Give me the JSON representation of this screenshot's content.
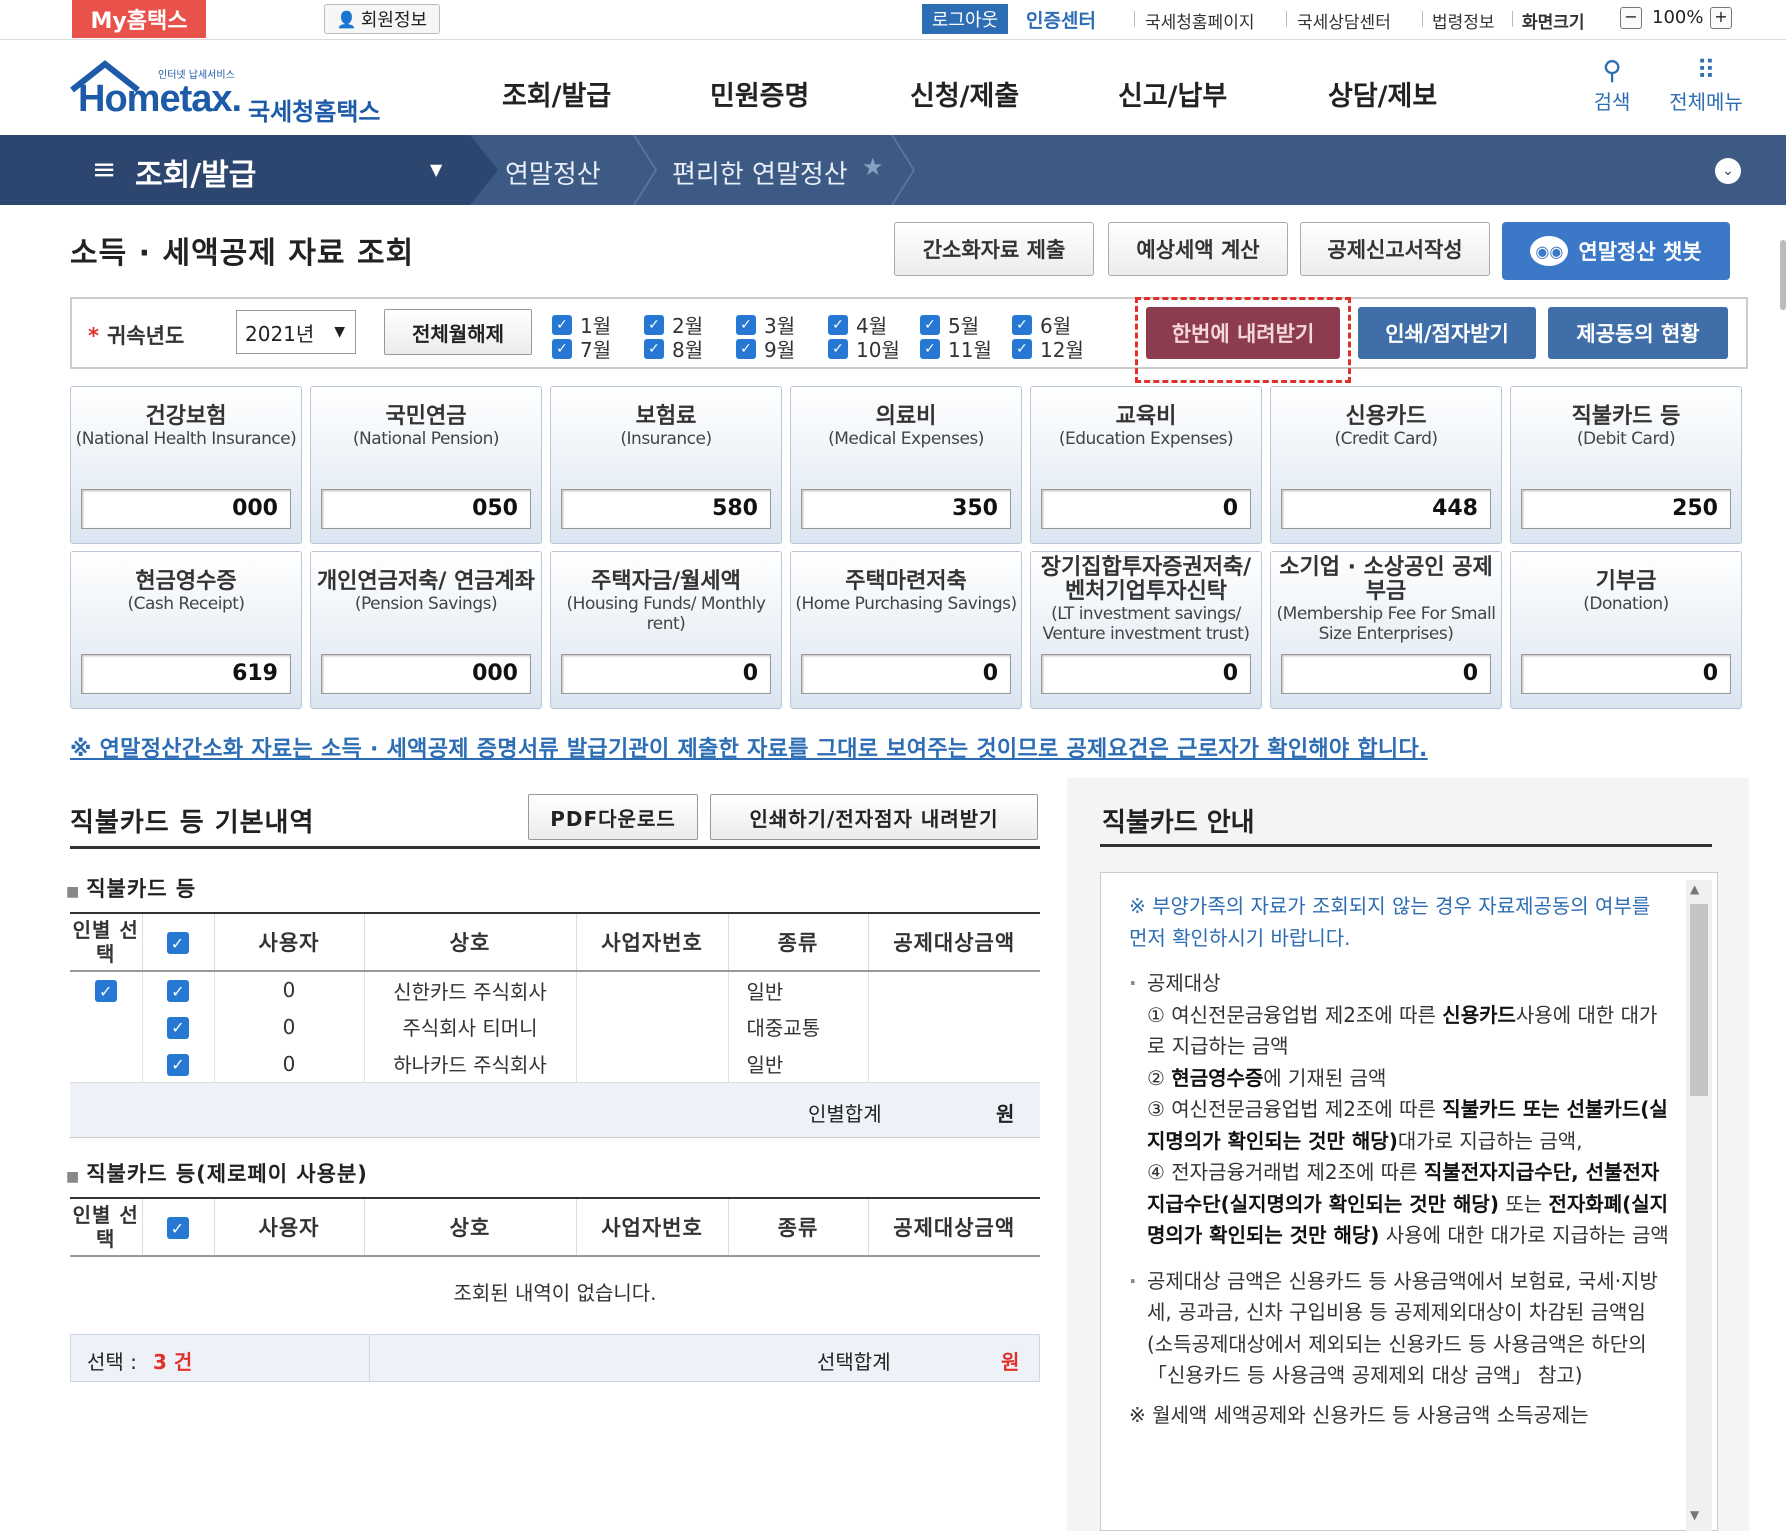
{
  "utilbar": {
    "my_hometax": "My홈택스",
    "member_info": "회원정보",
    "logout": "로그아웃",
    "cert_center": "인증센터",
    "links": [
      "국세청홈페이지",
      "국세상담센터",
      "법령정보",
      "화면크기"
    ],
    "zoom_minus": "−",
    "zoom_value": "100%",
    "zoom_plus": "+"
  },
  "header": {
    "logo_small": "인터넷 납세서비스",
    "logo_main": "Hometax.",
    "logo_korean": "국세청홈택스",
    "gnb": [
      "조회/발급",
      "민원증명",
      "신청/제출",
      "신고/납부",
      "상담/제보"
    ],
    "search_label": "검색",
    "allmenu_label": "전체메뉴"
  },
  "navbar": {
    "menu_icon": "≡",
    "selected": "조회/발급",
    "crumbs": [
      "연말정산",
      "편리한 연말정산"
    ]
  },
  "page": {
    "title": "소득 · 세액공제 자료 조회",
    "buttons": [
      "간소화자료 제출",
      "예상세액 계산",
      "공제신고서작성"
    ],
    "chatbot": "연말정산 챗봇"
  },
  "filter": {
    "year_label": "귀속년도",
    "year_value": "2021년",
    "all_month_button": "전체월해제",
    "months_top": [
      "1월",
      "2월",
      "3월",
      "4월",
      "5월",
      "6월"
    ],
    "months_bottom": [
      "7월",
      "8월",
      "9월",
      "10월",
      "11월",
      "12월"
    ],
    "download_all": "한번에 내려받기",
    "print_button": "인쇄/점자받기",
    "consent_button": "제공동의 현황"
  },
  "cards_row1": [
    {
      "ko": "건강보험",
      "en": "(National Health Insurance)",
      "value": "000"
    },
    {
      "ko": "국민연금",
      "en": "(National Pension)",
      "value": "050"
    },
    {
      "ko": "보험료",
      "en": "(Insurance)",
      "value": "580"
    },
    {
      "ko": "의료비",
      "en": "(Medical Expenses)",
      "value": "350"
    },
    {
      "ko": "교육비",
      "en": "(Education Expenses)",
      "value": "0"
    },
    {
      "ko": "신용카드",
      "en": "(Credit Card)",
      "value": "448"
    },
    {
      "ko": "직불카드 등",
      "en": "(Debit Card)",
      "value": "250"
    }
  ],
  "cards_row2": [
    {
      "ko": "현금영수증",
      "en": "(Cash Receipt)",
      "value": "619"
    },
    {
      "ko": "개인연금저축/ 연금계좌",
      "en": "(Pension Savings)",
      "value": "000"
    },
    {
      "ko": "주택자금/월세액",
      "en": "(Housing Funds/ Monthly rent)",
      "value": "0"
    },
    {
      "ko": "주택마련저축",
      "en": "(Home Purchasing Savings)",
      "value": "0"
    },
    {
      "ko": "장기집합투자증권저축/ 벤처기업투자신탁",
      "en": "(LT investment savings/ Venture investment trust)",
      "value": "0"
    },
    {
      "ko": "소기업 · 소상공인 공제부금",
      "en": "(Membership Fee For Small Size Enterprises)",
      "value": "0"
    },
    {
      "ko": "기부금",
      "en": "(Donation)",
      "value": "0"
    }
  ],
  "notice": "※ 연말정산간소화 자료는 소득 · 세액공제 증명서류 발급기관이 제출한 자료를 그대로 보여주는 것이므로 공제요건은 근로자가 확인해야 합니다.",
  "detail": {
    "title": "직불카드 등 기본내역",
    "pdf_button": "PDF다운로드",
    "print_button": "인쇄하기/전자점자 내려받기",
    "section1_title": "직불카드 등",
    "section2_title": "직불카드 등(제로페이 사용분)",
    "headers": [
      "인별 선택",
      "",
      "사용자",
      "상호",
      "사업자번호",
      "종류",
      "공제대상금액"
    ],
    "rows": [
      {
        "user": "0",
        "shop": "신한카드 주식회사",
        "type": "일반"
      },
      {
        "user": "0",
        "shop": "주식회사 티머니",
        "type": "대중교통"
      },
      {
        "user": "0",
        "shop": "하나카드 주식회사",
        "type": "일반"
      }
    ],
    "person_sum_label": "인별합계",
    "won": "원",
    "empty_message": "조회된 내역이 없습니다.",
    "selected_label": "선택 :",
    "selected_count": "3 건",
    "selected_sum_label": "선택합계"
  },
  "guide": {
    "title": "직불카드 안내",
    "note": "※ 부양가족의 자료가 조회되지 않는 경우 자료제공동의 여부를 먼저 확인하시기 바랍니다.",
    "target_title": "공제대상",
    "item1_a": "① 여신전문금융업법 제2조에 따른 ",
    "item1_b": "신용카드",
    "item1_c": "사용에 대한 대가로 지급하는 금액",
    "item2_a": "② ",
    "item2_b": "현금영수증",
    "item2_c": "에 기재된 금액",
    "item3_a": "③ 여신전문금융업법 제2조에 따른 ",
    "item3_b": "직불카드 또는 선불카드(실지명의가 확인되는 것만 해당)",
    "item3_c": "대가로 지급하는 금액,",
    "item4_a": "④ 전자금융거래법 제2조에 따른 ",
    "item4_b": "직불전자지급수단, 선불전자지급수단(실지명의가 확인되는 것만 해당)",
    "item4_c": " 또는 ",
    "item4_d": "전자화폐(실지명의가 확인되는 것만 해당)",
    "item4_e": " 사용에 대한 대가로 지급하는 금액",
    "bullet2": "공제대상 금액은 신용카드 등 사용금액에서 보험료, 국세·지방세, 공과금, 신차 구입비용 등 공제제외대상이 차감된 금액임(소득공제대상에서 제외되는 신용카드 등 사용금액은 하단의 「신용카드 등 사용금액 공제제외 대상 금액」 참고)",
    "note2": "※ 월세액 세액공제와 신용카드 등 사용금액 소득공제는"
  }
}
